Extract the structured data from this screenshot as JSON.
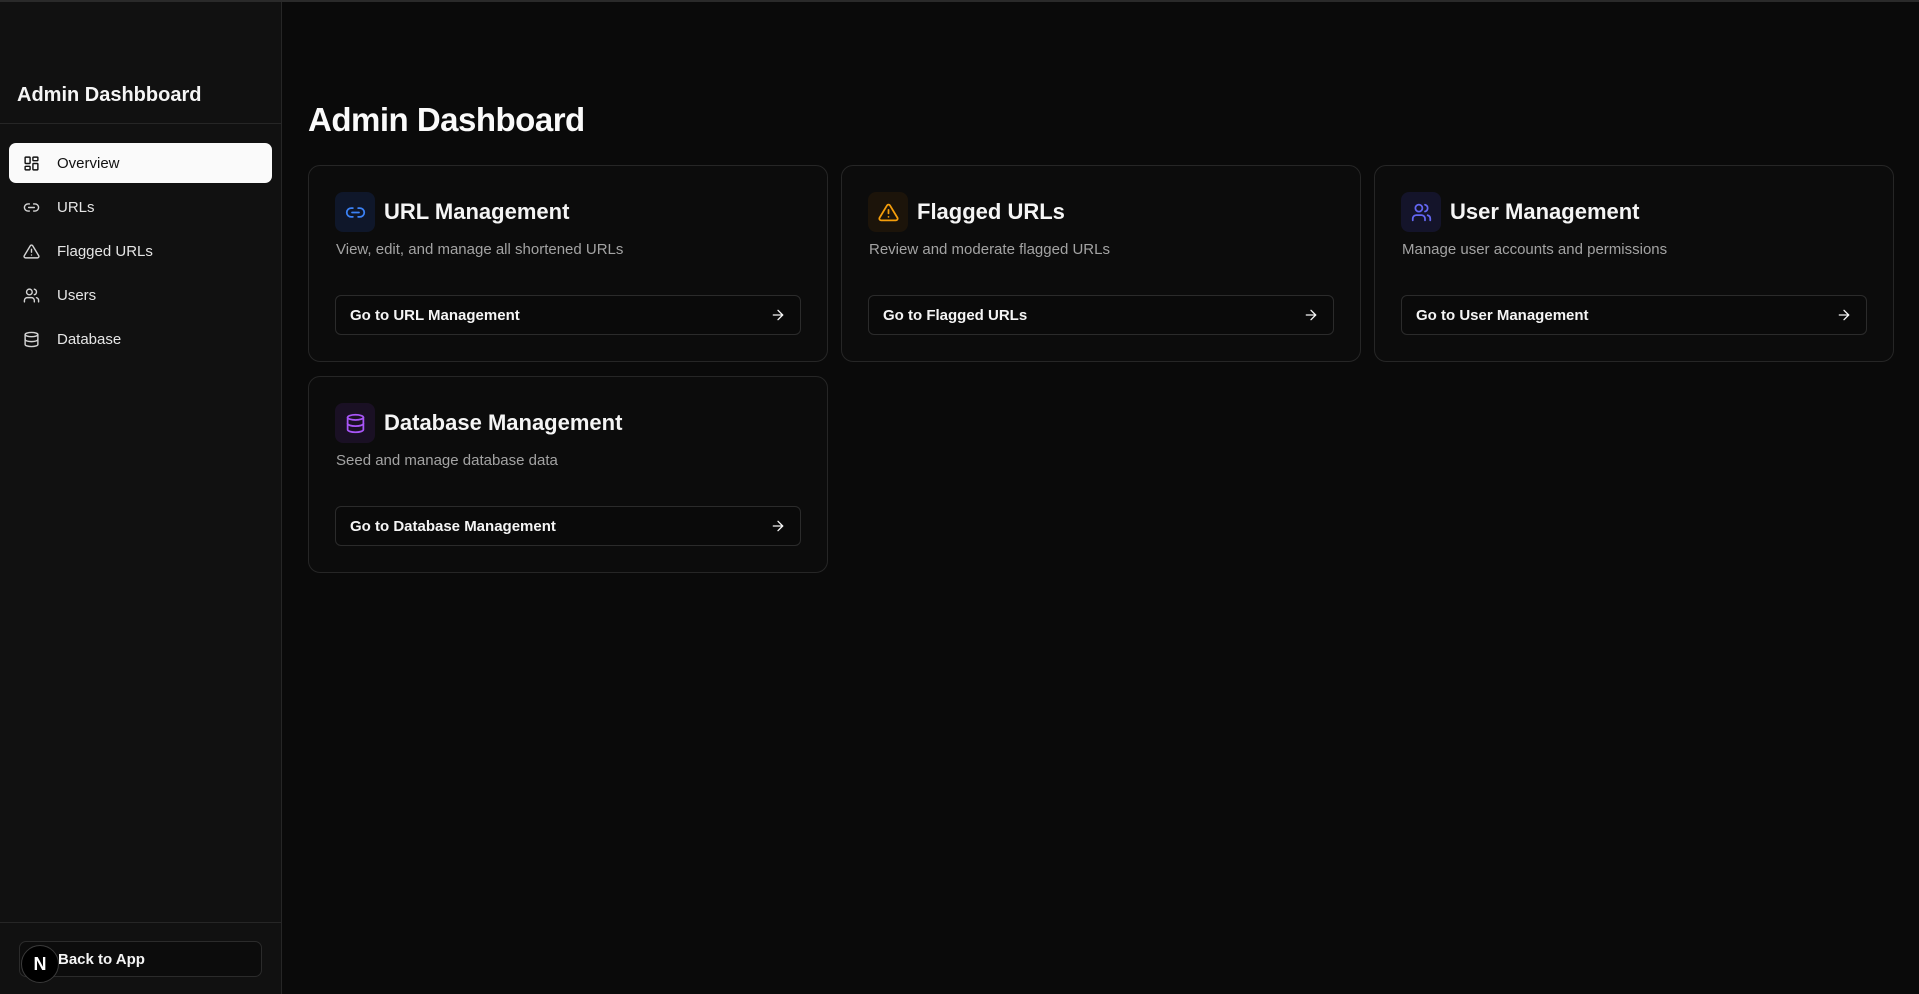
{
  "sidebar": {
    "title": "Admin Dashbboard",
    "items": [
      {
        "label": "Overview",
        "icon": "layout-grid-icon",
        "active": true
      },
      {
        "label": "URLs",
        "icon": "link-icon"
      },
      {
        "label": "Flagged URLs",
        "icon": "alert-triangle-icon"
      },
      {
        "label": "Users",
        "icon": "users-icon"
      },
      {
        "label": "Database",
        "icon": "database-icon"
      }
    ],
    "back_label": "Back to App",
    "badge_letter": "N"
  },
  "main": {
    "title": "Admin Dashboard",
    "cards": [
      {
        "title": "URL Management",
        "description": "View, edit, and manage all shortened URLs",
        "button": "Go to URL Management",
        "icon": "link-icon",
        "accent": "#3b82f6"
      },
      {
        "title": "Flagged URLs",
        "description": "Review and moderate flagged URLs",
        "button": "Go to Flagged URLs",
        "icon": "alert-triangle-icon",
        "accent": "#f59e0b"
      },
      {
        "title": "User Management",
        "description": "Manage user accounts and permissions",
        "button": "Go to User Management",
        "icon": "users-icon",
        "accent": "#6366f1"
      },
      {
        "title": "Database Management",
        "description": "Seed and manage database data",
        "button": "Go to Database Management",
        "icon": "database-icon",
        "accent": "#a855f7"
      }
    ]
  }
}
